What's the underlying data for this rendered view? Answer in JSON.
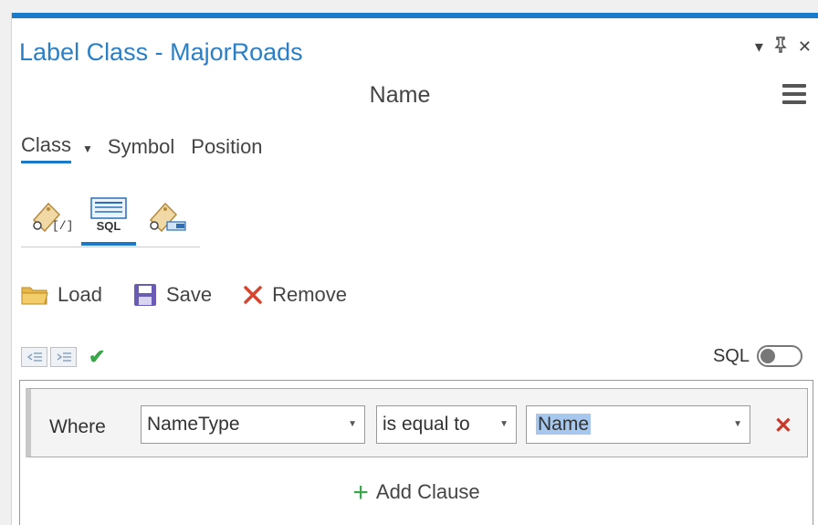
{
  "pane": {
    "title": "Label Class - MajorRoads",
    "controls": {
      "dropdown": "▾",
      "pin": "ᵖ",
      "close": "✕"
    }
  },
  "subtitle": "Name",
  "tabs": [
    {
      "label": "Class",
      "active": true
    },
    {
      "label": "Symbol",
      "active": false
    },
    {
      "label": "Position",
      "active": false
    }
  ],
  "modes": {
    "sql_label": "SQL"
  },
  "actions": {
    "load": "Load",
    "save": "Save",
    "remove": "Remove"
  },
  "sql_toggle": {
    "label": "SQL",
    "on": false
  },
  "clause": {
    "where": "Where",
    "field": "NameType",
    "operator": "is equal to",
    "value": "Name"
  },
  "add_clause": "Add Clause",
  "colors": {
    "accent": "#1b79c9",
    "remove_red": "#c9392a",
    "add_green": "#3aa64a"
  }
}
